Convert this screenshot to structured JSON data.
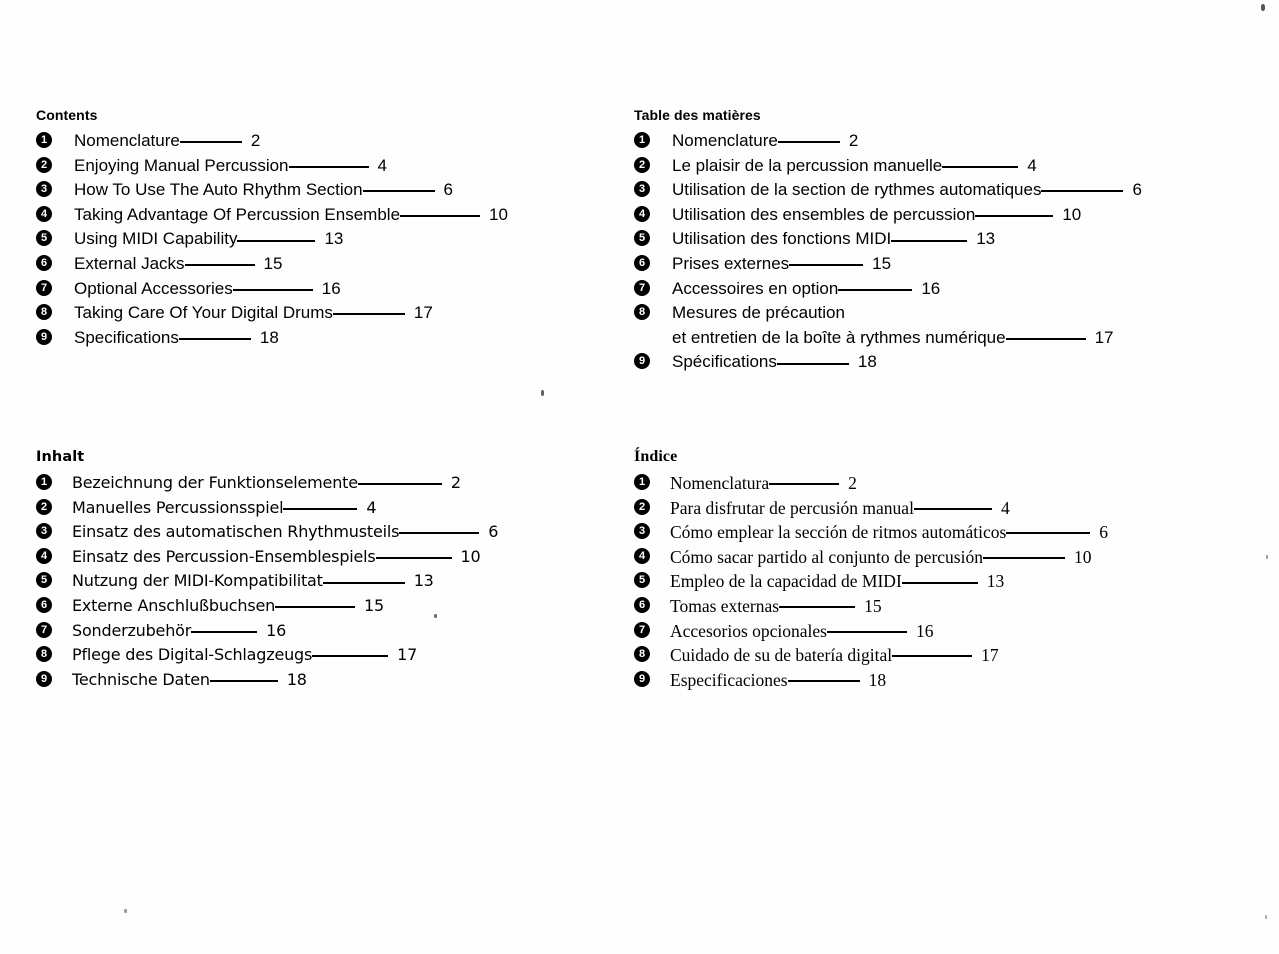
{
  "document": {
    "kind": "multilingual-table-of-contents",
    "page_background": "#fefefe",
    "text_color": "#000000"
  },
  "sections": {
    "english": {
      "heading": "Contents",
      "items": [
        {
          "bullet": "1",
          "title": "Nomenclature",
          "leader_width": 62,
          "page": "2"
        },
        {
          "bullet": "2",
          "title": "Enjoying Manual Percussion",
          "leader_width": 80,
          "page": "4"
        },
        {
          "bullet": "3",
          "title": "How To Use The Auto Rhythm Section",
          "leader_width": 72,
          "page": "6"
        },
        {
          "bullet": "4",
          "title": "Taking Advantage Of Percussion Ensemble",
          "leader_width": 80,
          "page": "10"
        },
        {
          "bullet": "5",
          "title": "Using MIDI Capability",
          "leader_width": 78,
          "page": "13"
        },
        {
          "bullet": "6",
          "title": "External Jacks",
          "leader_width": 70,
          "page": "15"
        },
        {
          "bullet": "7",
          "title": "Optional Accessories",
          "leader_width": 80,
          "page": "16"
        },
        {
          "bullet": "8",
          "title": "Taking Care Of Your Digital Drums",
          "leader_width": 72,
          "page": "17"
        },
        {
          "bullet": "9",
          "title": "Specifications",
          "leader_width": 72,
          "page": "18"
        }
      ]
    },
    "french": {
      "heading": "Table des matières",
      "items": [
        {
          "bullet": "1",
          "title": "Nomenclature",
          "leader_width": 62,
          "page": "2"
        },
        {
          "bullet": "2",
          "title": "Le plaisir de la percussion manuelle",
          "leader_width": 76,
          "page": "4"
        },
        {
          "bullet": "3",
          "title": "Utilisation de la section de rythmes automatiques",
          "leader_width": 82,
          "page": "6"
        },
        {
          "bullet": "4",
          "title": "Utilisation des ensembles de percussion",
          "leader_width": 78,
          "page": "10"
        },
        {
          "bullet": "5",
          "title": "Utilisation des fonctions MIDI",
          "leader_width": 76,
          "page": "13"
        },
        {
          "bullet": "6",
          "title": "Prises externes",
          "leader_width": 74,
          "page": "15"
        },
        {
          "bullet": "7",
          "title": "Accessoires en option",
          "leader_width": 74,
          "page": "16"
        },
        {
          "bullet": "8",
          "title": "Mesures de précaution",
          "leader_width": 0,
          "page": "",
          "continuation": "et entretien de la boîte à rythmes numérique",
          "continuation_leader_width": 80,
          "continuation_page": "17"
        },
        {
          "bullet": "9",
          "title": "Spécifications",
          "leader_width": 72,
          "page": "18"
        }
      ]
    },
    "german": {
      "heading": "Inhalt",
      "items": [
        {
          "bullet": "1",
          "title": "Bezeichnung der Funktionselemente",
          "leader_width": 84,
          "page": "2"
        },
        {
          "bullet": "2",
          "title": "Manuelles Percussionsspiel",
          "leader_width": 74,
          "page": "4"
        },
        {
          "bullet": "3",
          "title": "Einsatz des automatischen Rhythmusteils",
          "leader_width": 80,
          "page": "6"
        },
        {
          "bullet": "4",
          "title": "Einsatz des Percussion-Ensemblespiels",
          "leader_width": 76,
          "page": "10"
        },
        {
          "bullet": "5",
          "title": "Nutzung der MIDI-Kompatibilitat",
          "leader_width": 82,
          "page": "13"
        },
        {
          "bullet": "6",
          "title": "Externe Anschlußbuchsen",
          "leader_width": 80,
          "page": "15"
        },
        {
          "bullet": "7",
          "title": "Sonderzubehör ",
          "leader_width": 66,
          "page": "16"
        },
        {
          "bullet": "8",
          "title": "Pflege des Digital-Schlagzeugs",
          "leader_width": 76,
          "page": "17"
        },
        {
          "bullet": "9",
          "title": "Technische Daten",
          "leader_width": 68,
          "page": "18"
        }
      ]
    },
    "spanish": {
      "heading": "Índice",
      "items": [
        {
          "bullet": "1",
          "title": "Nomenclatura",
          "leader_width": 70,
          "page": "2"
        },
        {
          "bullet": "2",
          "title": "Para disfrutar de percusión manual",
          "leader_width": 78,
          "page": "4"
        },
        {
          "bullet": "3",
          "title": "Cómo emplear la sección de ritmos automáticos",
          "leader_width": 84,
          "page": "6"
        },
        {
          "bullet": "4",
          "title": "Cómo sacar partido al conjunto de percusión",
          "leader_width": 82,
          "page": "10"
        },
        {
          "bullet": "5",
          "title": "Empleo de la capacidad de MIDI",
          "leader_width": 76,
          "page": "13"
        },
        {
          "bullet": "6",
          "title": "Tomas externas",
          "leader_width": 76,
          "page": "15"
        },
        {
          "bullet": "7",
          "title": "Accesorios opcionales",
          "leader_width": 80,
          "page": "16"
        },
        {
          "bullet": "8",
          "title": "Cuidado de su de batería digital",
          "leader_width": 80,
          "page": "17"
        },
        {
          "bullet": "9",
          "title": "Especificaciones",
          "leader_width": 72,
          "page": "18"
        }
      ]
    }
  }
}
